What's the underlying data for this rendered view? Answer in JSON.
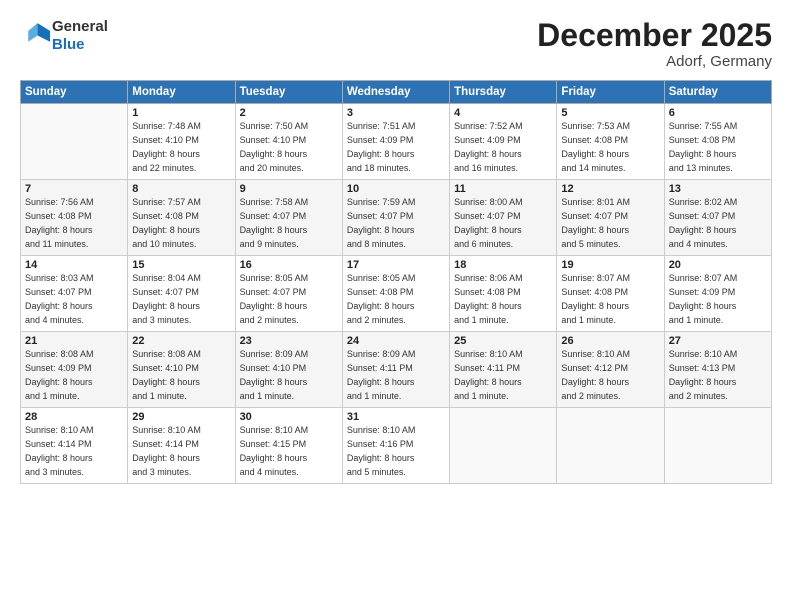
{
  "header": {
    "logo_line1": "General",
    "logo_line2": "Blue",
    "month": "December 2025",
    "location": "Adorf, Germany"
  },
  "weekdays": [
    "Sunday",
    "Monday",
    "Tuesday",
    "Wednesday",
    "Thursday",
    "Friday",
    "Saturday"
  ],
  "weeks": [
    [
      {
        "day": "",
        "info": ""
      },
      {
        "day": "1",
        "info": "Sunrise: 7:48 AM\nSunset: 4:10 PM\nDaylight: 8 hours\nand 22 minutes."
      },
      {
        "day": "2",
        "info": "Sunrise: 7:50 AM\nSunset: 4:10 PM\nDaylight: 8 hours\nand 20 minutes."
      },
      {
        "day": "3",
        "info": "Sunrise: 7:51 AM\nSunset: 4:09 PM\nDaylight: 8 hours\nand 18 minutes."
      },
      {
        "day": "4",
        "info": "Sunrise: 7:52 AM\nSunset: 4:09 PM\nDaylight: 8 hours\nand 16 minutes."
      },
      {
        "day": "5",
        "info": "Sunrise: 7:53 AM\nSunset: 4:08 PM\nDaylight: 8 hours\nand 14 minutes."
      },
      {
        "day": "6",
        "info": "Sunrise: 7:55 AM\nSunset: 4:08 PM\nDaylight: 8 hours\nand 13 minutes."
      }
    ],
    [
      {
        "day": "7",
        "info": "Sunrise: 7:56 AM\nSunset: 4:08 PM\nDaylight: 8 hours\nand 11 minutes."
      },
      {
        "day": "8",
        "info": "Sunrise: 7:57 AM\nSunset: 4:08 PM\nDaylight: 8 hours\nand 10 minutes."
      },
      {
        "day": "9",
        "info": "Sunrise: 7:58 AM\nSunset: 4:07 PM\nDaylight: 8 hours\nand 9 minutes."
      },
      {
        "day": "10",
        "info": "Sunrise: 7:59 AM\nSunset: 4:07 PM\nDaylight: 8 hours\nand 8 minutes."
      },
      {
        "day": "11",
        "info": "Sunrise: 8:00 AM\nSunset: 4:07 PM\nDaylight: 8 hours\nand 6 minutes."
      },
      {
        "day": "12",
        "info": "Sunrise: 8:01 AM\nSunset: 4:07 PM\nDaylight: 8 hours\nand 5 minutes."
      },
      {
        "day": "13",
        "info": "Sunrise: 8:02 AM\nSunset: 4:07 PM\nDaylight: 8 hours\nand 4 minutes."
      }
    ],
    [
      {
        "day": "14",
        "info": "Sunrise: 8:03 AM\nSunset: 4:07 PM\nDaylight: 8 hours\nand 4 minutes."
      },
      {
        "day": "15",
        "info": "Sunrise: 8:04 AM\nSunset: 4:07 PM\nDaylight: 8 hours\nand 3 minutes."
      },
      {
        "day": "16",
        "info": "Sunrise: 8:05 AM\nSunset: 4:07 PM\nDaylight: 8 hours\nand 2 minutes."
      },
      {
        "day": "17",
        "info": "Sunrise: 8:05 AM\nSunset: 4:08 PM\nDaylight: 8 hours\nand 2 minutes."
      },
      {
        "day": "18",
        "info": "Sunrise: 8:06 AM\nSunset: 4:08 PM\nDaylight: 8 hours\nand 1 minute."
      },
      {
        "day": "19",
        "info": "Sunrise: 8:07 AM\nSunset: 4:08 PM\nDaylight: 8 hours\nand 1 minute."
      },
      {
        "day": "20",
        "info": "Sunrise: 8:07 AM\nSunset: 4:09 PM\nDaylight: 8 hours\nand 1 minute."
      }
    ],
    [
      {
        "day": "21",
        "info": "Sunrise: 8:08 AM\nSunset: 4:09 PM\nDaylight: 8 hours\nand 1 minute."
      },
      {
        "day": "22",
        "info": "Sunrise: 8:08 AM\nSunset: 4:10 PM\nDaylight: 8 hours\nand 1 minute."
      },
      {
        "day": "23",
        "info": "Sunrise: 8:09 AM\nSunset: 4:10 PM\nDaylight: 8 hours\nand 1 minute."
      },
      {
        "day": "24",
        "info": "Sunrise: 8:09 AM\nSunset: 4:11 PM\nDaylight: 8 hours\nand 1 minute."
      },
      {
        "day": "25",
        "info": "Sunrise: 8:10 AM\nSunset: 4:11 PM\nDaylight: 8 hours\nand 1 minute."
      },
      {
        "day": "26",
        "info": "Sunrise: 8:10 AM\nSunset: 4:12 PM\nDaylight: 8 hours\nand 2 minutes."
      },
      {
        "day": "27",
        "info": "Sunrise: 8:10 AM\nSunset: 4:13 PM\nDaylight: 8 hours\nand 2 minutes."
      }
    ],
    [
      {
        "day": "28",
        "info": "Sunrise: 8:10 AM\nSunset: 4:14 PM\nDaylight: 8 hours\nand 3 minutes."
      },
      {
        "day": "29",
        "info": "Sunrise: 8:10 AM\nSunset: 4:14 PM\nDaylight: 8 hours\nand 3 minutes."
      },
      {
        "day": "30",
        "info": "Sunrise: 8:10 AM\nSunset: 4:15 PM\nDaylight: 8 hours\nand 4 minutes."
      },
      {
        "day": "31",
        "info": "Sunrise: 8:10 AM\nSunset: 4:16 PM\nDaylight: 8 hours\nand 5 minutes."
      },
      {
        "day": "",
        "info": ""
      },
      {
        "day": "",
        "info": ""
      },
      {
        "day": "",
        "info": ""
      }
    ]
  ]
}
